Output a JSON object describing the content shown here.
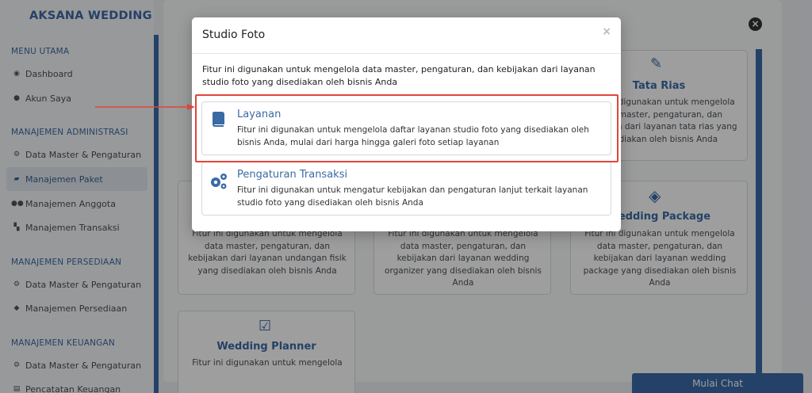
{
  "sidebar": {
    "brand": "AKSANA WEDDING",
    "sections": [
      {
        "title": "MENU UTAMA",
        "items": [
          {
            "label": "Dashboard",
            "icon": "dashboard-icon"
          },
          {
            "label": "Akun Saya",
            "icon": "user-icon"
          }
        ]
      },
      {
        "title": "MANAJEMEN ADMINISTRASI",
        "items": [
          {
            "label": "Data Master & Pengaturan",
            "icon": "gears-icon"
          },
          {
            "label": "Manajemen Paket",
            "icon": "book-icon",
            "active": true
          },
          {
            "label": "Manajemen Anggota",
            "icon": "users-icon"
          },
          {
            "label": "Manajemen Transaksi",
            "icon": "cart-icon"
          }
        ]
      },
      {
        "title": "MANAJEMEN PERSEDIAAN",
        "items": [
          {
            "label": "Data Master & Pengaturan",
            "icon": "gears-icon"
          },
          {
            "label": "Manajemen Persediaan",
            "icon": "cubes-icon"
          }
        ]
      },
      {
        "title": "MANAJEMEN KEUANGAN",
        "items": [
          {
            "label": "Data Master & Pengaturan",
            "icon": "gears-icon"
          },
          {
            "label": "Pencatatan Keuangan",
            "icon": "ledger-icon"
          }
        ]
      }
    ]
  },
  "cards": {
    "tata_rias": {
      "title": "Tata Rias",
      "desc": "Fitur ini digunakan untuk mengelola data master, pengaturan, dan kebijakan dari layanan tata rias yang disediakan oleh bisnis Anda",
      "icon": "magic-wand-icon"
    },
    "undangan": {
      "desc": "Fitur ini digunakan untuk mengelola data master, pengaturan, dan kebijakan dari layanan undangan fisik yang disediakan oleh bisnis Anda"
    },
    "organizer": {
      "desc": "Fitur ini digunakan untuk mengelola data master, pengaturan, dan kebijakan dari layanan wedding organizer yang disediakan oleh bisnis Anda"
    },
    "package": {
      "title": "Wedding Package",
      "desc": "Fitur ini digunakan untuk mengelola data master, pengaturan, dan kebijakan dari layanan wedding package yang disediakan oleh bisnis Anda",
      "icon": "cubes-icon"
    },
    "planner": {
      "title": "Wedding Planner",
      "desc": "Fitur ini digunakan untuk mengelola",
      "icon": "check-square-icon"
    }
  },
  "chat": {
    "label": "Mulai Chat"
  },
  "modal": {
    "title": "Studio Foto",
    "close": "×",
    "desc": "Fitur ini digunakan untuk mengelola data master, pengaturan, dan kebijakan dari layanan studio foto yang disediakan oleh bisnis Anda",
    "options": [
      {
        "title": "Layanan",
        "desc": "Fitur ini digunakan untuk mengelola daftar layanan studio foto yang disediakan oleh bisnis Anda, mulai dari harga hingga galeri foto setiap layanan",
        "icon": "book-icon"
      },
      {
        "title": "Pengaturan Transaksi",
        "desc": "Fitur ini digunakan untuk mengatur kebijakan dan pengaturan lanjut terkait layanan studio foto yang disediakan oleh bisnis Anda",
        "icon": "gears-icon"
      }
    ]
  },
  "colors": {
    "accent": "#3a6aa6",
    "highlight": "#e0453a"
  }
}
